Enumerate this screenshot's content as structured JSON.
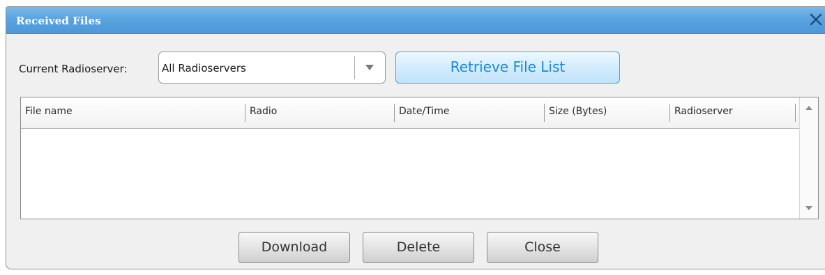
{
  "window": {
    "title": "Received Files",
    "accent_color": "#4f98d8"
  },
  "icons": {
    "close": "close-icon",
    "dropdown": "chevron-down-icon",
    "scroll_up": "scroll-up-icon",
    "scroll_down": "scroll-down-icon"
  },
  "server": {
    "label": "Current Radioserver:",
    "selected": "All Radioservers"
  },
  "retrieve_button": {
    "label": "Retrieve File List",
    "text_color": "#1a8ad8"
  },
  "table": {
    "columns": [
      "File name",
      "Radio",
      "Date/Time",
      "Size (Bytes)",
      "Radioserver"
    ],
    "rows": []
  },
  "buttons": {
    "download": "Download",
    "delete": "Delete",
    "close": "Close"
  }
}
